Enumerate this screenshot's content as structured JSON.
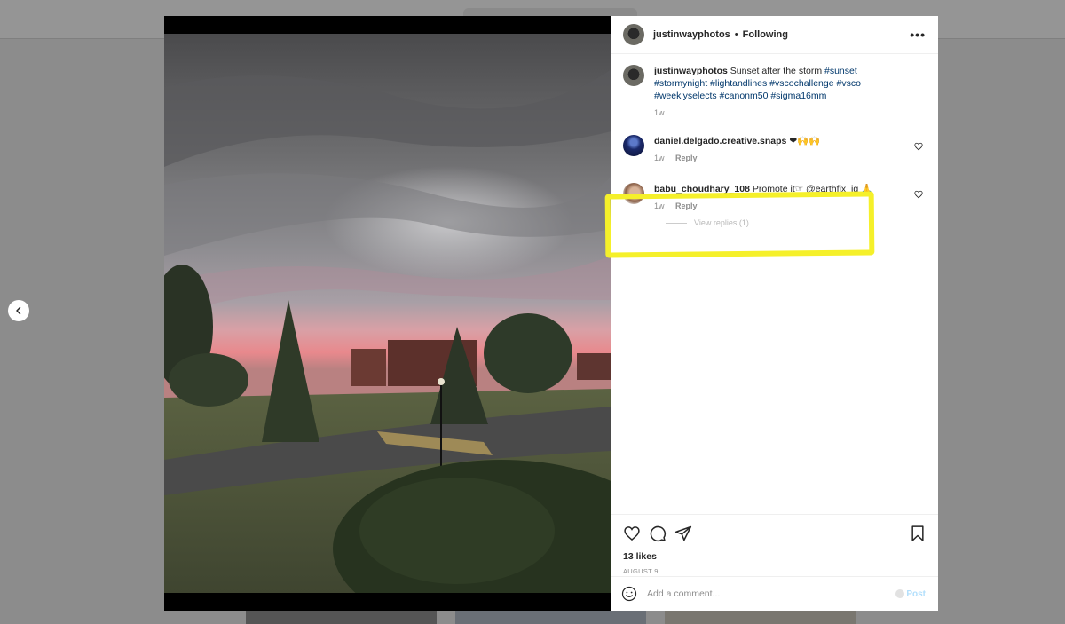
{
  "post": {
    "author": "justinwayphotos",
    "separator": "•",
    "follow_status": "Following",
    "more_label": "•••",
    "caption": {
      "user": "justinwayphotos",
      "text": "Sunset after the storm",
      "hashtags": [
        "#sunset",
        "#stormynight",
        "#lightandlines",
        "#vscochallenge",
        "#vsco",
        "#weeklyselects",
        "#canonm50",
        "#sigma16mm"
      ],
      "time": "1w"
    },
    "comments": [
      {
        "user": "daniel.delgado.creative.snaps",
        "text": "❤🙌🙌",
        "time": "1w",
        "reply_label": "Reply"
      },
      {
        "user": "babu_choudhary_108",
        "text": "Promote it☞ @earthfix_ig 🙏",
        "time": "1w",
        "reply_label": "Reply"
      }
    ],
    "view_replies": "View replies (1)",
    "likes": "13 likes",
    "date": "AUGUST 9"
  },
  "composer": {
    "placeholder": "Add a comment...",
    "post_label": "Post"
  },
  "icons": {
    "like": "heart-icon",
    "comment": "comment-icon",
    "share": "share-icon",
    "save": "bookmark-icon",
    "emoji": "emoji-icon",
    "more": "more-options-icon",
    "prev": "chevron-left-icon"
  },
  "colors": {
    "highlight": "#f5f02a",
    "hashtag": "#00376b",
    "post_disabled": "#b2dffc"
  }
}
